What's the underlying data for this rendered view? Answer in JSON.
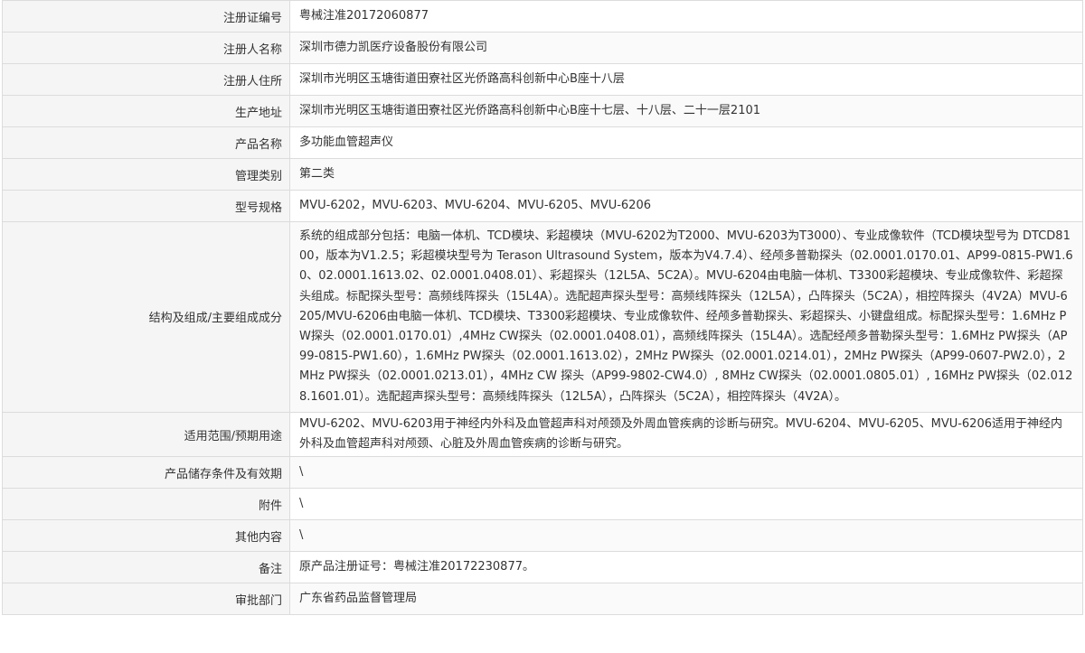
{
  "rows": [
    {
      "label": "注册证编号",
      "value": "粤械注准20172060877"
    },
    {
      "label": "注册人名称",
      "value": "深圳市德力凯医疗设备股份有限公司"
    },
    {
      "label": "注册人住所",
      "value": "深圳市光明区玉塘街道田寮社区光侨路高科创新中心B座十八层"
    },
    {
      "label": "生产地址",
      "value": "深圳市光明区玉塘街道田寮社区光侨路高科创新中心B座十七层、十八层、二十一层2101"
    },
    {
      "label": "产品名称",
      "value": "多功能血管超声仪"
    },
    {
      "label": "管理类别",
      "value": "第二类"
    },
    {
      "label": "型号规格",
      "value": "MVU-6202，MVU-6203、MVU-6204、MVU-6205、MVU-6206"
    },
    {
      "label": "结构及组成/主要组成成分",
      "value": "系统的组成部分包括：电脑一体机、TCD模块、彩超模块（MVU-6202为T2000、MVU-6203为T3000）、专业成像软件（TCD模块型号为 DTCD8100，版本为V1.2.5；彩超模块型号为 Terason Ultrasound System，版本为V4.7.4）、经颅多普勒探头（02.0001.0170.01、AP99-0815-PW1.60、02.0001.1613.02、02.0001.0408.01）、彩超探头（12L5A、5C2A）。MVU-6204由电脑一体机、T3300彩超模块、专业成像软件、彩超探头组成。标配探头型号：高频线阵探头（15L4A）。选配超声探头型号：高频线阵探头（12L5A），凸阵探头（5C2A），相控阵探头（4V2A）MVU-6205/MVU-6206由电脑一体机、TCD模块、T3300彩超模块、专业成像软件、经颅多普勒探头、彩超探头、小键盘组成。标配探头型号：1.6MHz PW探头（02.0001.0170.01）,4MHz CW探头（02.0001.0408.01），高频线阵探头（15L4A）。选配经颅多普勒探头型号：1.6MHz PW探头（AP99-0815-PW1.60），1.6MHz PW探头（02.0001.1613.02），2MHz PW探头（02.0001.0214.01），2MHz PW探头（AP99-0607-PW2.0），2MHz PW探头（02.0001.0213.01），4MHz CW 探头（AP99-9802-CW4.0）, 8MHz CW探头（02.0001.0805.01）, 16MHz PW探头（02.0128.1601.01）。选配超声探头型号：高频线阵探头（12L5A），凸阵探头（5C2A），相控阵探头（4V2A）。"
    },
    {
      "label": "适用范围/预期用途",
      "value": "MVU-6202、MVU-6203用于神经内外科及血管超声科对颅颈及外周血管疾病的诊断与研究。MVU-6204、MVU-6205、MVU-6206适用于神经内外科及血管超声科对颅颈、心脏及外周血管疾病的诊断与研究。"
    },
    {
      "label": "产品储存条件及有效期",
      "value": "\\"
    },
    {
      "label": "附件",
      "value": "\\"
    },
    {
      "label": "其他内容",
      "value": "\\"
    },
    {
      "label": "备注",
      "value": "原产品注册证号：粤械注准20172230877。"
    },
    {
      "label": "审批部门",
      "value": "广东省药品监督管理局"
    }
  ]
}
